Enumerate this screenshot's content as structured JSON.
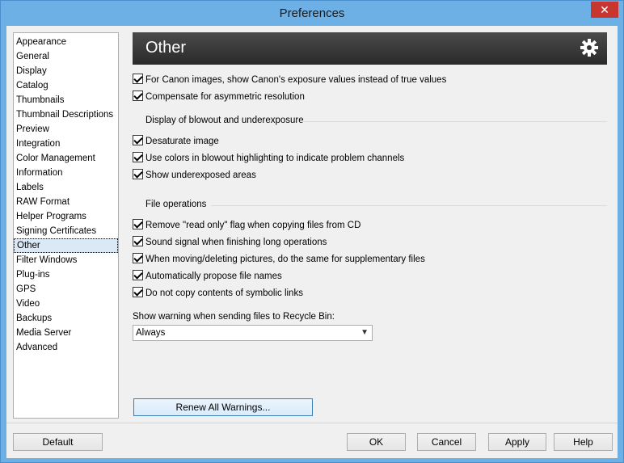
{
  "window": {
    "title": "Preferences",
    "close_label": "✕"
  },
  "sidebar": {
    "items": [
      "Appearance",
      "General",
      "Display",
      "Catalog",
      "Thumbnails",
      "Thumbnail Descriptions",
      "Preview",
      "Integration",
      "Color Management",
      "Information",
      "Labels",
      "RAW Format",
      "Helper Programs",
      "Signing Certificates",
      "Other",
      "Filter Windows",
      "Plug-ins",
      "GPS",
      "Video",
      "Backups",
      "Media Server",
      "Advanced"
    ],
    "selected": "Other"
  },
  "panel": {
    "title": "Other",
    "header_icon": "gear-icon",
    "opt_canon": "For Canon images, show Canon's exposure values instead of true values",
    "opt_asym": "Compensate for asymmetric resolution",
    "group_blowout": "Display of blowout and underexposure",
    "opt_desat": "Desaturate image",
    "opt_colors": "Use colors in blowout highlighting to indicate problem channels",
    "opt_under": "Show underexposed areas",
    "group_fileops": "File operations",
    "opt_readonly": "Remove \"read only\" flag when copying files from CD",
    "opt_sound": "Sound signal when finishing long operations",
    "opt_moving": "When moving/deleting pictures, do the same for supplementary files",
    "opt_propose": "Automatically propose file names",
    "opt_symlink": "Do not copy contents of symbolic links",
    "recycle_label": "Show warning when sending files to Recycle Bin:",
    "recycle_value": "Always",
    "renew_label": "Renew All Warnings..."
  },
  "buttons": {
    "default": "Default",
    "ok": "OK",
    "cancel": "Cancel",
    "apply": "Apply",
    "help": "Help"
  }
}
